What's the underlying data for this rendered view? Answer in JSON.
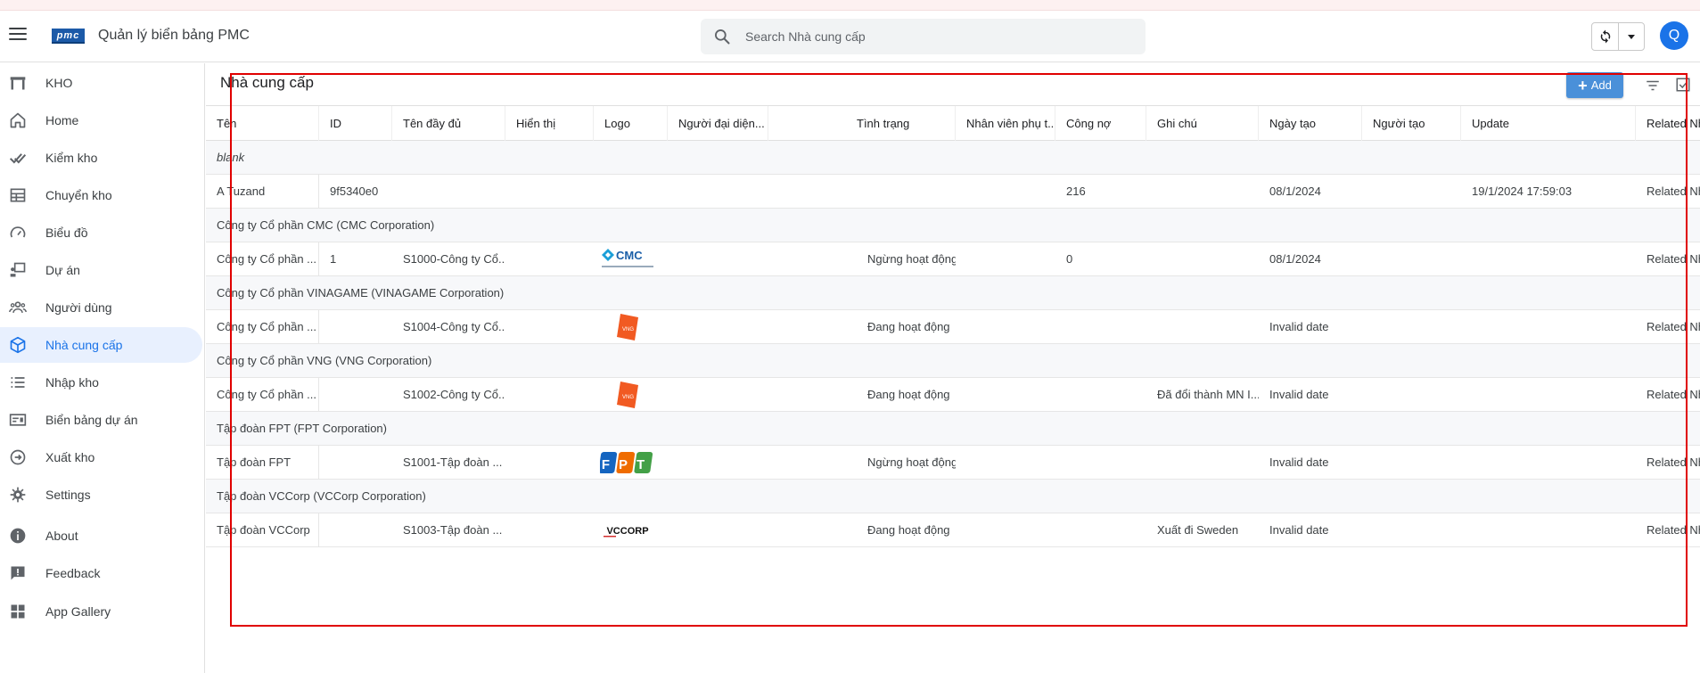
{
  "header": {
    "app_title": "Quản lý biển bảng PMC",
    "logo_text": "pmc",
    "search_placeholder": "Search Nhà cung cấp",
    "avatar_initial": "Q"
  },
  "sidebar": {
    "items": [
      {
        "label": "KHO",
        "icon": "warehouse-icon"
      },
      {
        "label": "Home",
        "icon": "home-icon"
      },
      {
        "label": "Kiểm kho",
        "icon": "double-check-icon"
      },
      {
        "label": "Chuyển kho",
        "icon": "table-icon"
      },
      {
        "label": "Biểu đồ",
        "icon": "speedometer-icon"
      },
      {
        "label": "Dự án",
        "icon": "presentation-icon"
      },
      {
        "label": "Người dùng",
        "icon": "users-icon"
      },
      {
        "label": "Nhà cung cấp",
        "icon": "cube-icon",
        "active": true
      },
      {
        "label": "Nhập kho",
        "icon": "list-icon"
      },
      {
        "label": "Biển bảng dự án",
        "icon": "card-icon"
      },
      {
        "label": "Xuất kho",
        "icon": "arrow-circle-icon"
      },
      {
        "label": "Settings",
        "icon": "gear-icon"
      },
      {
        "label": "About",
        "icon": "info-icon"
      },
      {
        "label": "Feedback",
        "icon": "feedback-icon"
      },
      {
        "label": "App Gallery",
        "icon": "apps-icon"
      }
    ]
  },
  "page": {
    "title": "Nhà cung cấp",
    "add_label": "Add"
  },
  "table": {
    "columns": [
      "Tên",
      "ID",
      "Tên đầy đủ",
      "Hiển thị",
      "Logo",
      "Người đại diện...",
      "Tình trạng",
      "Nhân viên phụ t...",
      "Công nợ",
      "Ghi chú",
      "Ngày tạo",
      "Người tạo",
      "Update",
      "Related Nh"
    ],
    "groups": [
      {
        "label": "blank",
        "italic": true,
        "row": {
          "ten": "A Tuzand",
          "id": "9f5340e0",
          "full": "",
          "logo": "",
          "status": "",
          "debt": "216",
          "note": "",
          "created": "08/1/2024",
          "update": "19/1/2024 17:59:03",
          "related": "Related Nh"
        }
      },
      {
        "label": "Công ty Cổ phần CMC (CMC Corporation)",
        "row": {
          "ten": "Công ty Cổ phần ...",
          "id": "1",
          "full": "S1000-Công ty Cổ...",
          "logo": "CMC",
          "status": "Ngừng hoạt động",
          "debt": "0",
          "note": "",
          "created": "08/1/2024",
          "update": "",
          "related": "Related Nh"
        }
      },
      {
        "label": "Công ty Cổ phần VINAGAME (VINAGAME Corporation)",
        "row": {
          "ten": "Công ty Cổ phần ...",
          "id": "",
          "full": "S1004-Công ty Cổ...",
          "logo": "VNG",
          "status": "Đang hoạt động",
          "debt": "",
          "note": "",
          "created": "Invalid date",
          "update": "",
          "related": "Related Nh"
        }
      },
      {
        "label": "Công ty Cổ phần VNG (VNG Corporation)",
        "row": {
          "ten": "Công ty Cổ phần ...",
          "id": "",
          "full": "S1002-Công ty Cổ...",
          "logo": "VNG",
          "status": "Đang hoạt động",
          "debt": "",
          "note": "Đã đổi thành MN I...",
          "created": "Invalid date",
          "update": "",
          "related": "Related Nh"
        }
      },
      {
        "label": "Tập đoàn FPT (FPT Corporation)",
        "row": {
          "ten": "Tập đoàn FPT",
          "id": "",
          "full": "S1001-Tập đoàn ...",
          "logo": "FPT",
          "status": "Ngừng hoạt động",
          "debt": "",
          "note": "",
          "created": "Invalid date",
          "update": "",
          "related": "Related Nh"
        }
      },
      {
        "label": "Tập đoàn VCCorp (VCCorp Corporation)",
        "row": {
          "ten": "Tập đoàn VCCorp",
          "id": "",
          "full": "S1003-Tập đoàn ...",
          "logo": "VCCORP",
          "status": "Đang hoạt động",
          "debt": "",
          "note": "Xuất đi Sweden",
          "created": "Invalid date",
          "update": "",
          "related": "Related Nh"
        }
      }
    ]
  }
}
